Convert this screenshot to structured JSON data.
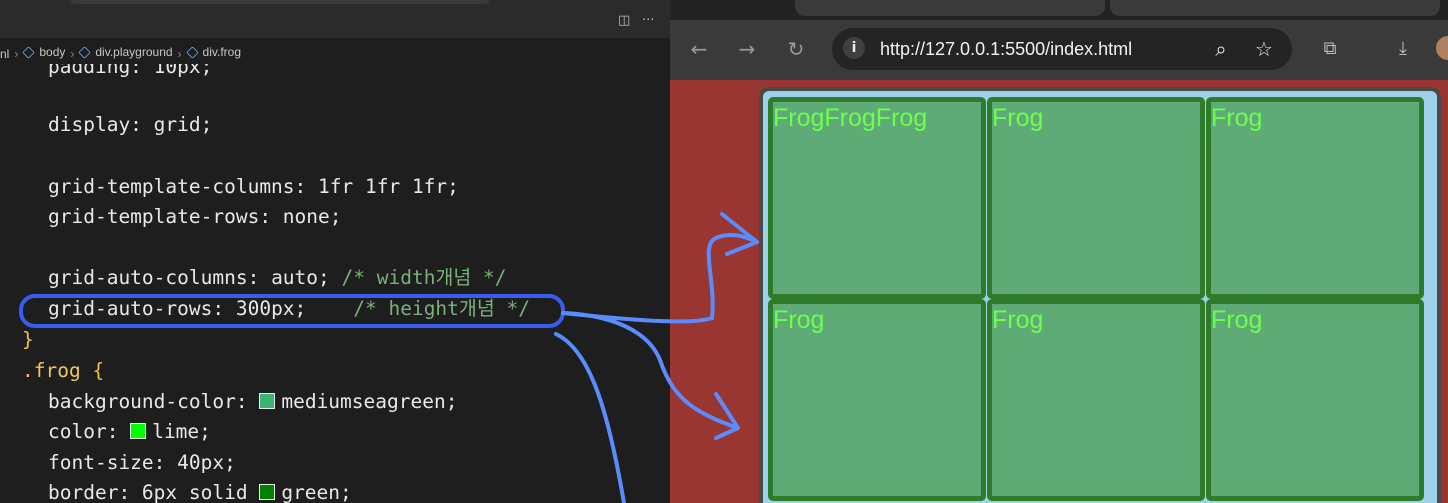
{
  "editor": {
    "actions": {
      "split": "◫",
      "more": "···"
    },
    "breadcrumb": {
      "items": [
        {
          "label": "nl",
          "icon": ""
        },
        {
          "label": "body",
          "icon": "element-icon"
        },
        {
          "label": "div.playground",
          "icon": "element-icon"
        },
        {
          "label": "div.frog",
          "icon": "element-icon"
        }
      ]
    },
    "lines": [
      {
        "prop": "padding:",
        "value": " 10px;"
      },
      {
        "prop": "display:",
        "value": " grid;"
      },
      {
        "prop": "grid-template-columns:",
        "value": " 1fr 1fr 1fr;"
      },
      {
        "prop": "grid-template-rows:",
        "value": " none;"
      },
      {
        "prop": "grid-auto-columns:",
        "value": " auto;",
        "comment": " /* width개념 */"
      },
      {
        "prop": "grid-auto-rows:",
        "value": " 300px;",
        "comment": "    /* height개념 */"
      },
      {
        "brace": "}"
      },
      {
        "selector": ".frog",
        "brace": " {"
      },
      {
        "prop": "background-color:",
        "swatch": "#3cb371",
        "value": "mediumseagreen;"
      },
      {
        "prop": "color:",
        "swatch": "#00ff00",
        "value": "lime;"
      },
      {
        "prop": "font-size:",
        "value": " 40px;"
      },
      {
        "prop": "border:",
        "value": " 6px solid ",
        "swatch": "#008000",
        "value2": "green;"
      }
    ],
    "highlight_color": "#3a5cf0",
    "arrow_color": "#5a8cff"
  },
  "browser": {
    "nav": {
      "back": "←",
      "forward": "→",
      "reload": "↻"
    },
    "url": "http://127.0.0.1:5500/index.html",
    "icons": {
      "info": "i",
      "zoom": "⌕",
      "bookmark": "☆",
      "extensions": "⧉",
      "download": "⤓"
    },
    "colors": {
      "page_bg": "#9a3632",
      "playground_bg": "#9fd1e8",
      "frog_bg": "#5fab78",
      "frog_border": "#2e7c2a",
      "frog_text": "#6dff4a"
    },
    "frogs": [
      {
        "text": "FrogFrogFrog"
      },
      {
        "text": "Frog"
      },
      {
        "text": "Frog"
      },
      {
        "text": "Frog"
      },
      {
        "text": "Frog"
      },
      {
        "text": "Frog"
      }
    ]
  }
}
